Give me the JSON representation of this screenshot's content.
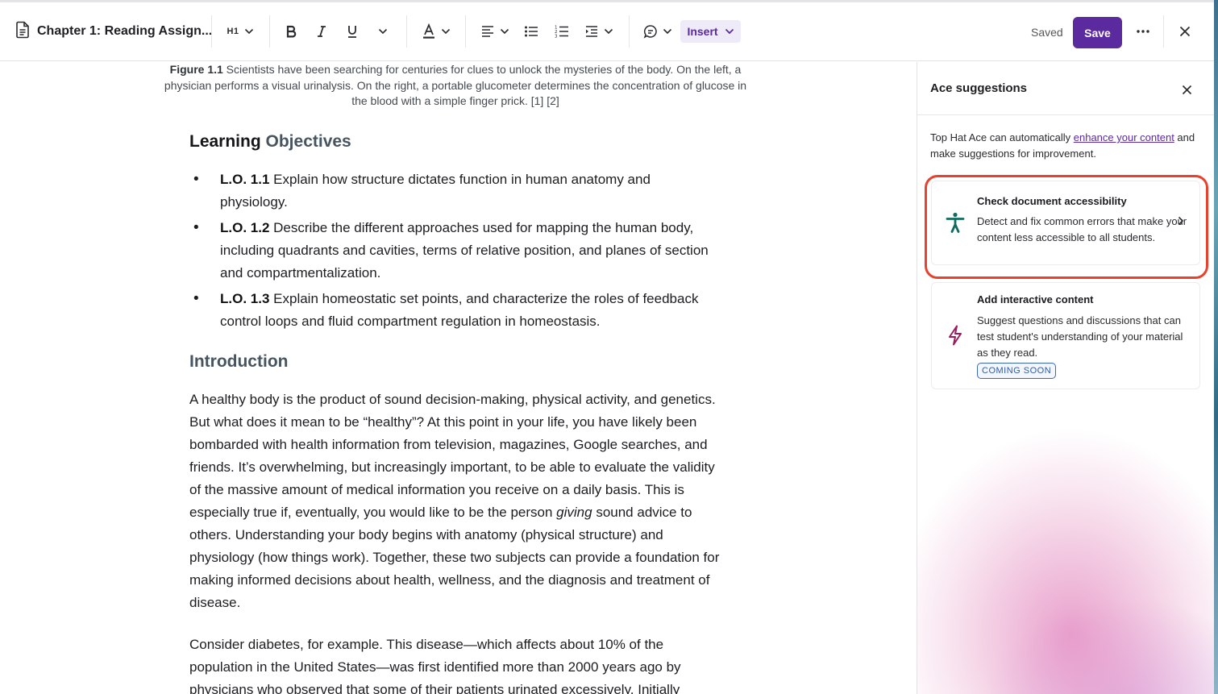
{
  "toolbar": {
    "doc_title": "Chapter 1: Reading Assign...",
    "heading_level": "H1",
    "insert_label": "Insert",
    "saved_status": "Saved",
    "save_label": "Save"
  },
  "editor": {
    "caption_label": "Figure 1.1",
    "caption_text": " Scientists have been searching for centuries for clues to unlock the mysteries of the body. On the left, a physician performs a visual urinalysis. On the right, a portable glucometer determines the concentration of glucose in the blood with a simple finger prick. [1] [2]",
    "objectives_heading_1": "Learning ",
    "objectives_heading_2": "Objectives",
    "objectives": [
      {
        "code": "L.O. 1.1",
        "text": " Explain how structure dictates function in human anatomy and physiology."
      },
      {
        "code": "L.O. 1.2",
        "text": " Describe the different approaches used for mapping the human body, including quadrants and cavities, terms of relative position, and planes of section and compartmentalization."
      },
      {
        "code": "L.O. 1.3",
        "text": " Explain homeostatic set points, and characterize the roles of feedback control loops and fluid compartment regulation in homeostasis."
      }
    ],
    "intro_heading": "Introduction",
    "intro_p1_a": "A healthy body is the product of sound decision-making, physical activity, and genetics. But what does it mean to be “healthy”? At this point in your life, you have likely been bombarded with health information from television, magazines, Google searches, and friends. It’s overwhelming, but increasingly important, to be able to evaluate the validity of the massive amount of medical information you receive on a daily basis. This is especially true if, eventually, you would like to be the person ",
    "intro_p1_em": "giving",
    "intro_p1_b": " sound advice to others. Understanding your body begins with anatomy (physical structure) and physiology (how things work). Together, these two subjects can provide a foundation for making informed decisions about health, wellness, and the diagnosis and treatment of disease.",
    "intro_p2": "Consider diabetes, for example. This disease—which affects about 10% of the population in the United States—was first identified more than 2000 years ago by physicians who observed that some of their patients urinated excessively. Initially"
  },
  "panel": {
    "title": "Ace suggestions",
    "intro_a": "Top Hat Ace can automatically ",
    "intro_link": "enhance your content",
    "intro_b": " and make suggestions for improvement.",
    "cards": [
      {
        "title": "Check document accessibility",
        "desc": "Detect and fix common errors that make your content less accessible to all students.",
        "icon": "accessibility-icon"
      },
      {
        "title": "Add interactive content",
        "desc": "Suggest questions and discussions that can test student's understanding of your material as they read.",
        "badge": "COMING SOON",
        "icon": "lightning-icon"
      }
    ]
  },
  "colors": {
    "brand": "#5b2a9f",
    "highlight": "#e8412d",
    "accessibility_icon": "#0f6b5e",
    "lightning_icon": "#9b1c5c"
  }
}
